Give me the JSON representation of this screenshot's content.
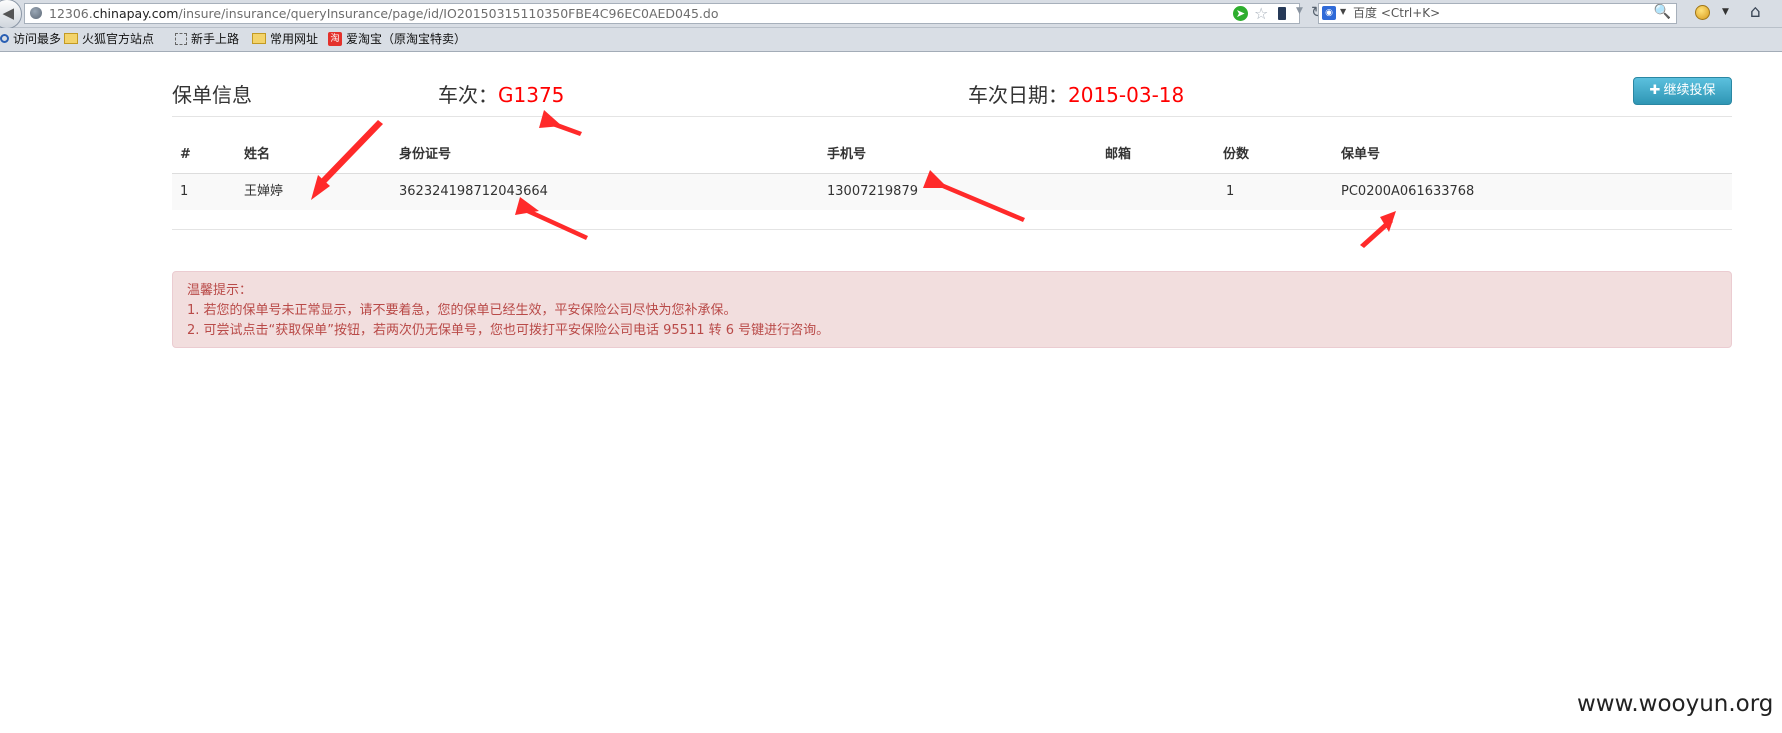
{
  "browser": {
    "url_prefix": "12306.",
    "url_domain": "chinapay.com",
    "url_path": "/insure/insurance/queryInsurance/page/id/IO20150315110350FBE4C96EC0AED045.do",
    "search_placeholder": "百度 <Ctrl+K>",
    "search_engine_icon": "baidu-icon",
    "bookmarks": [
      "访问最多",
      "火狐官方站点",
      "新手上路",
      "常用网址",
      "爱淘宝（原淘宝特卖）"
    ]
  },
  "page": {
    "section_title": "保单信息",
    "train_label": "车次：",
    "train_value": "G1375",
    "date_label": "车次日期：",
    "date_value": "2015-03-18",
    "continue_button": "继续投保",
    "continue_icon": "plus-icon",
    "accent_red": "#ff0000"
  },
  "table": {
    "headers": [
      "#",
      "姓名",
      "身份证号",
      "手机号",
      "邮箱",
      "份数",
      "保单号"
    ],
    "rows": [
      [
        "1",
        "王婵婷",
        "362324198712043664",
        "13007219879",
        "",
        "1",
        "PC0200A061633768"
      ]
    ]
  },
  "notice": {
    "title": "温馨提示：",
    "lines": [
      "1. 若您的保单号未正常显示，请不要着急，您的保单已经生效，平安保险公司尽快为您补承保。",
      "2. 可尝试点击“获取保单”按钮，若两次仍无保单号，您也可拨打平安保险公司电话 95511 转 6 号键进行咨询。"
    ],
    "bg_color": "#f2dede",
    "text_color": "#b94a48"
  },
  "watermark": "www.wooyun.org"
}
